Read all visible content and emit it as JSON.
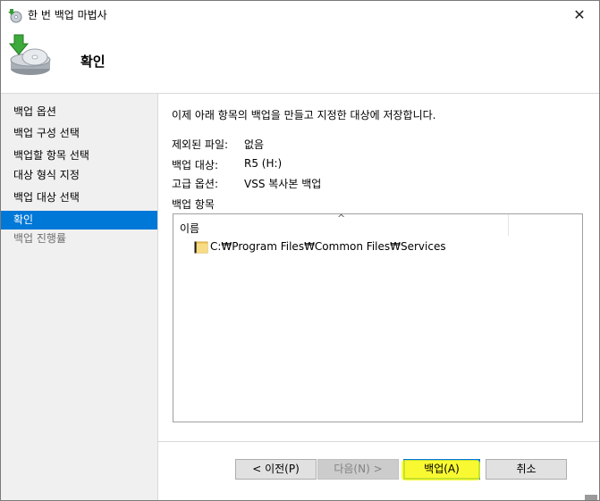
{
  "window": {
    "title": "한 번 백업 마법사",
    "close_glyph": "✕"
  },
  "header": {
    "title": "확인",
    "icon": "backup-disc-icon"
  },
  "sidebar": {
    "items": [
      {
        "label": "백업 옵션",
        "state": "normal"
      },
      {
        "label": "백업 구성 선택",
        "state": "normal"
      },
      {
        "label": "백업할 항목 선택",
        "state": "normal"
      },
      {
        "label": "대상 형식 지정",
        "state": "normal"
      },
      {
        "label": "백업 대상 선택",
        "state": "normal"
      },
      {
        "label": "확인",
        "state": "selected"
      },
      {
        "label": "백업 진행률",
        "state": "disabled"
      }
    ]
  },
  "main": {
    "intro": "이제 아래 항목의 백업을 만들고 지정한 대상에 저장합니다.",
    "details": [
      {
        "label": "제외된 파일:",
        "value": "없음"
      },
      {
        "label": "백업 대상:",
        "value": "R5 (H:)"
      },
      {
        "label": "고급 옵션:",
        "value": "VSS 복사본 백업"
      }
    ],
    "items_label": "백업 항목",
    "list": {
      "column": "이름",
      "sort_glyph": "^",
      "rows": [
        {
          "path": "C:₩Program Files₩Common Files₩Services",
          "icon": "folder-icon"
        }
      ]
    }
  },
  "footer": {
    "prev": "< 이전(P)",
    "next": "다음(N) >",
    "backup": "백업(A)",
    "cancel": "취소"
  },
  "colors": {
    "selection": "#0078d7",
    "highlight": "#ffff00"
  }
}
